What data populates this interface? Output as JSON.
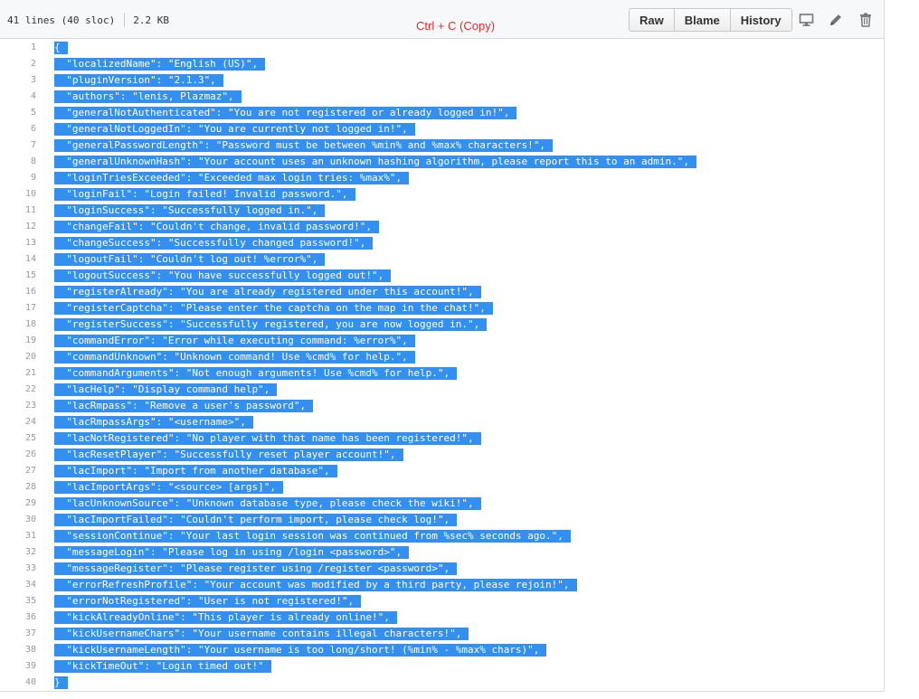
{
  "file": {
    "lines_info": "41 lines (40 sloc)",
    "size": "2.2 KB"
  },
  "copy_hint": "Ctrl + C (Copy)",
  "toolbar": {
    "raw_label": "Raw",
    "blame_label": "Blame",
    "history_label": "History"
  },
  "icons": {
    "desktop": "desktop-icon",
    "edit": "pencil-icon",
    "delete": "trash-icon"
  },
  "selection_color": "#3390f0",
  "lines": [
    {
      "num": "1",
      "text": "{"
    },
    {
      "num": "2",
      "text": "  \"localizedName\": \"English (US)\","
    },
    {
      "num": "3",
      "text": "  \"pluginVersion\": \"2.1.3\","
    },
    {
      "num": "4",
      "text": "  \"authors\": \"lenis, Plazmaz\","
    },
    {
      "num": "5",
      "text": "  \"generalNotAuthenticated\": \"You are not registered or already logged in!\","
    },
    {
      "num": "6",
      "text": "  \"generalNotLoggedIn\": \"You are currently not logged in!\","
    },
    {
      "num": "7",
      "text": "  \"generalPasswordLength\": \"Password must be between %min% and %max% characters!\","
    },
    {
      "num": "8",
      "text": "  \"generalUnknownHash\": \"Your account uses an unknown hashing algorithm, please report this to an admin.\","
    },
    {
      "num": "9",
      "text": "  \"loginTriesExceeded\": \"Exceeded max login tries: %max%\","
    },
    {
      "num": "10",
      "text": "  \"loginFail\": \"Login failed! Invalid password.\","
    },
    {
      "num": "11",
      "text": "  \"loginSuccess\": \"Successfully logged in.\","
    },
    {
      "num": "12",
      "text": "  \"changeFail\": \"Couldn't change, invalid password!\","
    },
    {
      "num": "13",
      "text": "  \"changeSuccess\": \"Successfully changed password!\","
    },
    {
      "num": "14",
      "text": "  \"logoutFail\": \"Couldn't log out! %error%\","
    },
    {
      "num": "15",
      "text": "  \"logoutSuccess\": \"You have successfully logged out!\","
    },
    {
      "num": "16",
      "text": "  \"registerAlready\": \"You are already registered under this account!\","
    },
    {
      "num": "17",
      "text": "  \"registerCaptcha\": \"Please enter the captcha on the map in the chat!\","
    },
    {
      "num": "18",
      "text": "  \"registerSuccess\": \"Successfully registered, you are now logged in.\","
    },
    {
      "num": "19",
      "text": "  \"commandError\": \"Error while executing command: %error%\","
    },
    {
      "num": "20",
      "text": "  \"commandUnknown\": \"Unknown command! Use %cmd% for help.\","
    },
    {
      "num": "21",
      "text": "  \"commandArguments\": \"Not enough arguments! Use %cmd% for help.\","
    },
    {
      "num": "22",
      "text": "  \"lacHelp\": \"Display command help\","
    },
    {
      "num": "23",
      "text": "  \"lacRmpass\": \"Remove a user's password\","
    },
    {
      "num": "24",
      "text": "  \"lacRmpassArgs\": \"<username>\","
    },
    {
      "num": "25",
      "text": "  \"lacNotRegistered\": \"No player with that name has been registered!\","
    },
    {
      "num": "26",
      "text": "  \"lacResetPlayer\": \"Successfully reset player account!\","
    },
    {
      "num": "27",
      "text": "  \"lacImport\": \"Import from another database\","
    },
    {
      "num": "28",
      "text": "  \"lacImportArgs\": \"<source> [args]\","
    },
    {
      "num": "29",
      "text": "  \"lacUnknownSource\": \"Unknown database type, please check the wiki!\","
    },
    {
      "num": "30",
      "text": "  \"lacImportFailed\": \"Couldn't perform import, please check log!\","
    },
    {
      "num": "31",
      "text": "  \"sessionContinue\": \"Your last login session was continued from %sec% seconds ago.\","
    },
    {
      "num": "32",
      "text": "  \"messageLogin\": \"Please log in using /login <password>\","
    },
    {
      "num": "33",
      "text": "  \"messageRegister\": \"Please register using /register <password>\","
    },
    {
      "num": "34",
      "text": "  \"errorRefreshProfile\": \"Your account was modified by a third party, please rejoin!\","
    },
    {
      "num": "35",
      "text": "  \"errorNotRegistered\": \"User is not registered!\","
    },
    {
      "num": "36",
      "text": "  \"kickAlreadyOnline\": \"This player is already online!\","
    },
    {
      "num": "37",
      "text": "  \"kickUsernameChars\": \"Your username contains illegal characters!\","
    },
    {
      "num": "38",
      "text": "  \"kickUsernameLength\": \"Your username is too long/short! (%min% - %max% chars)\","
    },
    {
      "num": "39",
      "text": "  \"kickTimeOut\": \"Login timed out!\""
    },
    {
      "num": "40",
      "text": "}"
    }
  ]
}
